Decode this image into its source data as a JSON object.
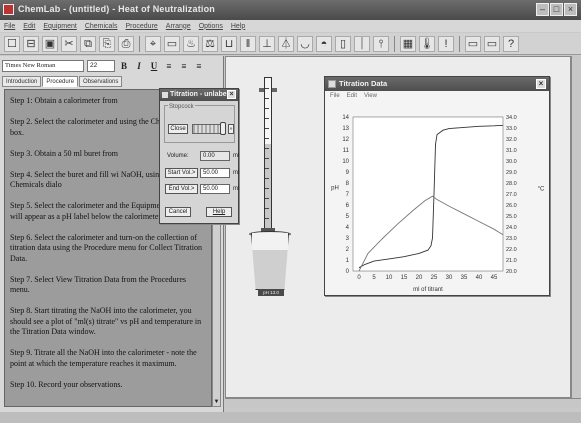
{
  "titlebar": {
    "title": "ChemLab - (untitled) - Heat of Neutralization"
  },
  "menubar": [
    "File",
    "Edit",
    "Equipment",
    "Chemicals",
    "Procedure",
    "Arrange",
    "Options",
    "Help"
  ],
  "toolbar": {
    "new": "☐",
    "open": "⊟",
    "save": "▣",
    "cut": "✂",
    "copy": "⧉",
    "paste": "⎘",
    "print": "⎙"
  },
  "format": {
    "font": "Times New Roman",
    "size": "22",
    "bold": "B",
    "italic": "I",
    "underline": "U"
  },
  "tabs": [
    "Introduction",
    "Procedure",
    "Observations"
  ],
  "active_tab": "Procedure",
  "procedure": [
    "Step 1: Obtain a calorimeter from",
    "Step 2. Select the calorimeter and using the Chemicals dialog box.",
    "Step 3. Obtain a 50 ml buret from",
    "Step 4. Select the buret and fill wi NaOH, using the Chemicals dialo",
    "Step 5. Select the calorimeter and the Equipment menu - this will appear as a pH label below the calorimeter.",
    "Step 6. Select the calorimeter and turn-on the collection of titration data using the Procedure menu for Collect Titration Data.",
    "Step 7. Select View Titration Data from the Procedures menu.",
    "Step 8. Start titrating the NaOH into the calorimeter, you should see a plot of \"ml(s) titrate\" vs pH and temperature in the Titration Data window.",
    "Step 9. Titrate all the NaOH into the calorimeter - note the point at which the temperature reaches it maximum.",
    "Step 10. Record your observations."
  ],
  "titration_dialog": {
    "title": "Titration - unlabel",
    "group_label": "Stopcock",
    "close_label": "Close",
    "volume_label": "Volume:",
    "volume_value": "0.00",
    "start_label": "Start Vol.>",
    "start_value": "50.00",
    "end_label": "End Vol.>",
    "end_value": "50.00",
    "unit": "ml",
    "cancel_label": "Cancel",
    "help_label": "Help"
  },
  "beaker": {
    "label": "pH 13.0"
  },
  "data_window": {
    "title": "Titration Data",
    "menu": [
      "File",
      "Edit",
      "View"
    ]
  },
  "chart_data": {
    "type": "line",
    "xlabel": "ml of titrant",
    "ylabel": "pH",
    "y2label": "°C",
    "xlim": [
      -2,
      48
    ],
    "ylim": [
      0,
      14
    ],
    "y2lim": [
      20,
      34
    ],
    "xticks": [
      0,
      5,
      10,
      15,
      20,
      25,
      30,
      35,
      40,
      45
    ],
    "yticks": [
      0,
      1,
      2,
      3,
      4,
      5,
      6,
      7,
      8,
      9,
      10,
      11,
      12,
      13,
      14
    ],
    "y2ticks": [
      "20.0",
      "21.0",
      "22.0",
      "23.0",
      "24.0",
      "25.0",
      "26.0",
      "27.0",
      "28.0",
      "29.0",
      "30.0",
      "31.0",
      "32.0",
      "33.0",
      "34.0"
    ],
    "grid": true,
    "series": [
      {
        "axis": "left",
        "color": "#333333",
        "x": [
          0,
          2,
          5,
          10,
          15,
          20,
          23,
          24,
          24.5,
          25,
          25.5,
          26,
          28,
          30,
          35,
          40,
          45,
          48
        ],
        "y": [
          0.3,
          0.6,
          0.9,
          1.1,
          1.3,
          1.6,
          1.9,
          2.3,
          3.0,
          7.0,
          11.5,
          12.4,
          12.8,
          12.95,
          13.05,
          13.15,
          13.2,
          13.25
        ]
      },
      {
        "axis": "right",
        "color": "#777777",
        "x": [
          0,
          3,
          8,
          13,
          18,
          22,
          24.5,
          26,
          30,
          35,
          40,
          45,
          48
        ],
        "y": [
          20.0,
          21.6,
          23.0,
          24.3,
          25.5,
          26.4,
          26.8,
          26.5,
          25.9,
          25.2,
          24.5,
          23.8,
          23.3
        ]
      }
    ]
  }
}
